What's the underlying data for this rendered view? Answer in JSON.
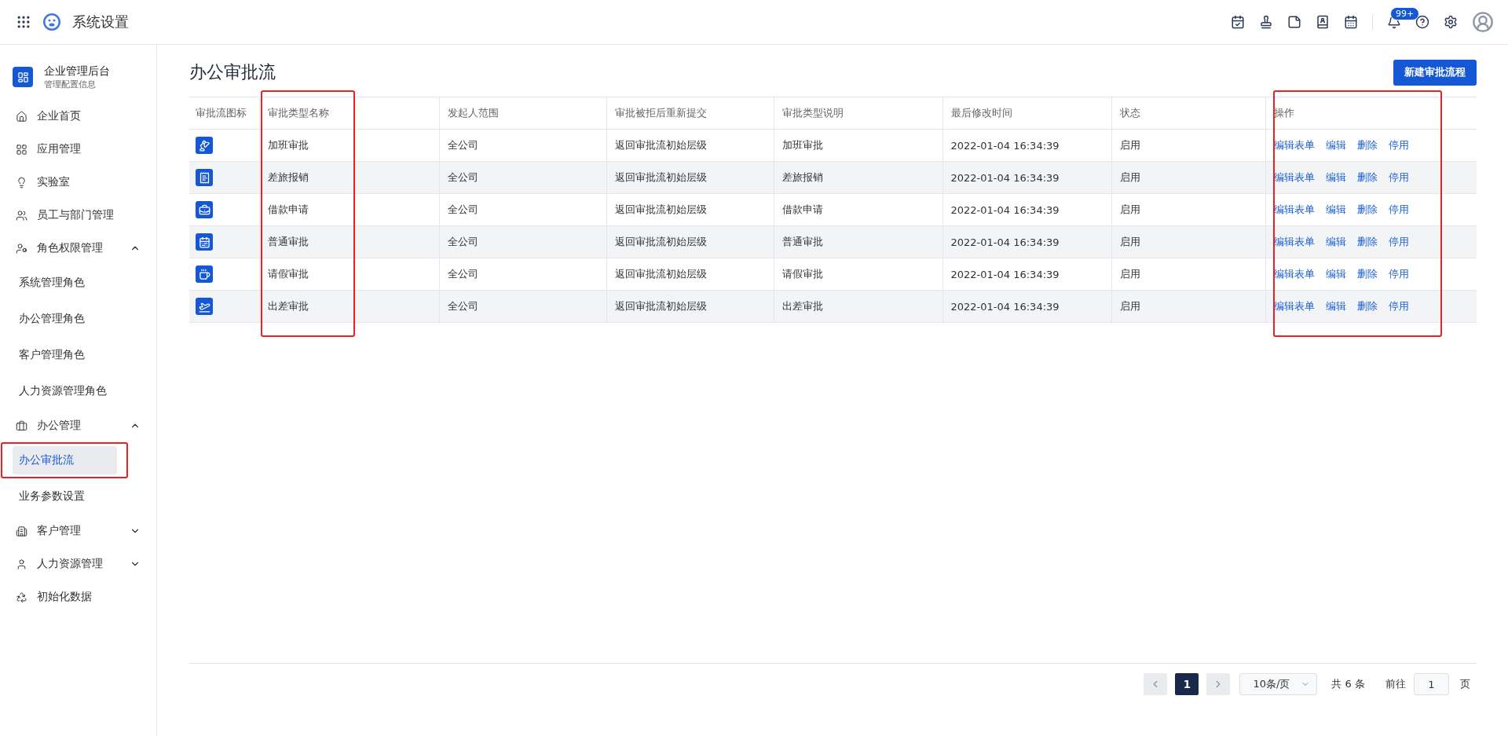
{
  "header": {
    "title": "系统设置",
    "notification_badge": "99+"
  },
  "sidebar": {
    "title": "企业管理后台",
    "subtitle": "管理配置信息",
    "items": [
      {
        "label": "企业首页"
      },
      {
        "label": "应用管理"
      },
      {
        "label": "实验室"
      },
      {
        "label": "员工与部门管理"
      },
      {
        "label": "角色权限管理",
        "expanded": true,
        "children": [
          {
            "label": "系统管理角色",
            "selected": false,
            "annotated": false
          },
          {
            "label": "办公管理角色",
            "selected": false,
            "annotated": false
          },
          {
            "label": "客户管理角色",
            "selected": false,
            "annotated": false
          },
          {
            "label": "人力资源管理角色",
            "selected": false,
            "annotated": false
          }
        ]
      },
      {
        "label": "办公管理",
        "expanded": true,
        "children": [
          {
            "label": "办公审批流",
            "selected": true,
            "annotated": true
          },
          {
            "label": "业务参数设置",
            "selected": false,
            "annotated": false
          }
        ]
      },
      {
        "label": "客户管理",
        "expanded": false
      },
      {
        "label": "人力资源管理",
        "expanded": false
      },
      {
        "label": "初始化数据"
      }
    ]
  },
  "page": {
    "title": "办公审批流",
    "new_button": "新建审批流程"
  },
  "table": {
    "columns": [
      {
        "label": "审批流图标",
        "annotated": false
      },
      {
        "label": "审批类型名称",
        "annotated": true
      },
      {
        "label": "发起人范围",
        "annotated": false
      },
      {
        "label": "审批被拒后重新提交",
        "annotated": false
      },
      {
        "label": "审批类型说明",
        "annotated": false
      },
      {
        "label": "最后修改时间",
        "annotated": false
      },
      {
        "label": "状态",
        "annotated": false
      },
      {
        "label": "操作",
        "annotated": true
      }
    ],
    "rows": [
      {
        "cells": [
          "",
          "加班审批",
          "全公司",
          "返回审批流初始层级",
          "加班审批",
          "2022-01-04 16:34:39",
          "启用"
        ],
        "actions": [
          "编辑表单",
          "编辑",
          "删除",
          "停用"
        ]
      },
      {
        "cells": [
          "",
          "差旅报销",
          "全公司",
          "返回审批流初始层级",
          "差旅报销",
          "2022-01-04 16:34:39",
          "启用"
        ],
        "actions": [
          "编辑表单",
          "编辑",
          "删除",
          "停用"
        ]
      },
      {
        "cells": [
          "",
          "借款申请",
          "全公司",
          "返回审批流初始层级",
          "借款申请",
          "2022-01-04 16:34:39",
          "启用"
        ],
        "actions": [
          "编辑表单",
          "编辑",
          "删除",
          "停用"
        ]
      },
      {
        "cells": [
          "",
          "普通审批",
          "全公司",
          "返回审批流初始层级",
          "普通审批",
          "2022-01-04 16:34:39",
          "启用"
        ],
        "actions": [
          "编辑表单",
          "编辑",
          "删除",
          "停用"
        ]
      },
      {
        "cells": [
          "",
          "请假审批",
          "全公司",
          "返回审批流初始层级",
          "请假审批",
          "2022-01-04 16:34:39",
          "启用"
        ],
        "actions": [
          "编辑表单",
          "编辑",
          "删除",
          "停用"
        ]
      },
      {
        "cells": [
          "",
          "出差审批",
          "全公司",
          "返回审批流初始层级",
          "出差审批",
          "2022-01-04 16:34:39",
          "启用"
        ],
        "actions": [
          "编辑表单",
          "编辑",
          "删除",
          "停用"
        ]
      }
    ]
  },
  "pagination": {
    "pages": [
      {
        "label": "1",
        "selected": true
      }
    ],
    "page_size": "10条/页",
    "total": "共 6 条",
    "goto_label": "前往",
    "goto_value": "1",
    "page_suffix": "页"
  }
}
